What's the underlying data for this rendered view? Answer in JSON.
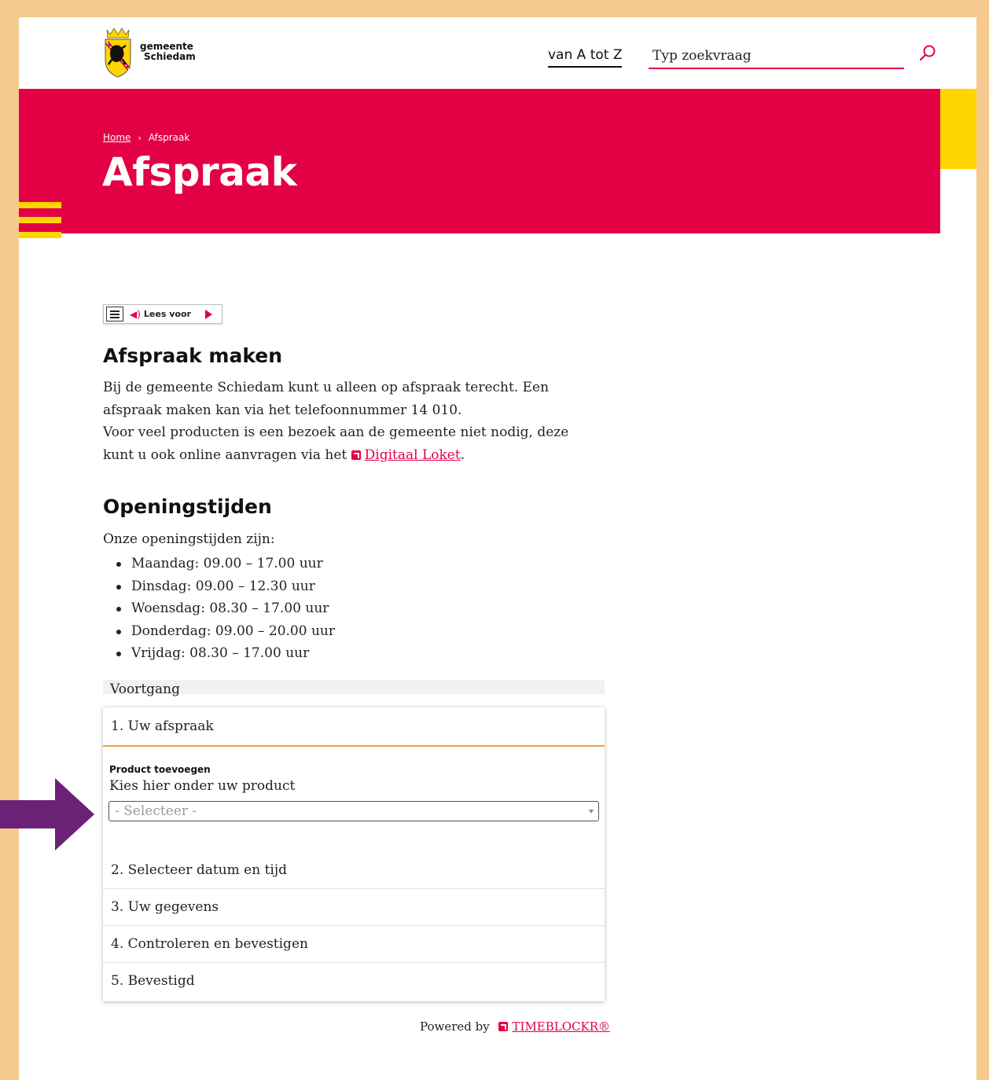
{
  "header": {
    "logo_line1": "gemeente",
    "logo_line2": "Schiedam",
    "nav_az": "van A tot Z",
    "search_placeholder": "Typ zoekvraag",
    "search_icon": "search-icon"
  },
  "colors": {
    "brand_red": "#e30045",
    "brand_yellow": "#ffd500",
    "frame": "#f6c98f",
    "step_accent": "#f0a24a",
    "arrow": "#6b2175"
  },
  "breadcrumb": {
    "home": "Home",
    "separator": "›",
    "current": "Afspraak"
  },
  "page_title": "Afspraak",
  "readspeaker": {
    "label": "Lees voor"
  },
  "intro": {
    "heading": "Afspraak maken",
    "line1": "Bij de gemeente Schiedam kunt u alleen op afspraak terecht. Een afspraak maken kan via het telefoonnummer 14 010.",
    "line2_prefix": "Voor veel producten is een bezoek aan de gemeente niet nodig, deze kunt u ook online aanvragen via het",
    "line2_link": "Digitaal Loket",
    "line2_suffix": "."
  },
  "hours": {
    "heading": "Openingstijden",
    "intro": "Onze openingstijden zijn:",
    "items": [
      "Maandag: 09.00 – 17.00 uur",
      "Dinsdag: 09.00 – 12.30 uur",
      "Woensdag: 08.30 – 17.00 uur",
      "Donderdag: 09.00 – 20.00 uur",
      "Vrijdag: 08.30 – 17.00 uur"
    ]
  },
  "widget": {
    "progress_label": "Voortgang",
    "step1": "1. Uw afspraak",
    "product_label": "Product toevoegen",
    "product_help": "Kies hier onder uw product",
    "product_select_value": "- Selecteer -",
    "steps": [
      "2. Selecteer datum en tijd",
      "3. Uw gegevens",
      "4. Controleren en bevestigen",
      "5. Bevestigd"
    ]
  },
  "footer": {
    "powered_prefix": "Powered by",
    "powered_link": "TIMEBLOCKR®"
  }
}
